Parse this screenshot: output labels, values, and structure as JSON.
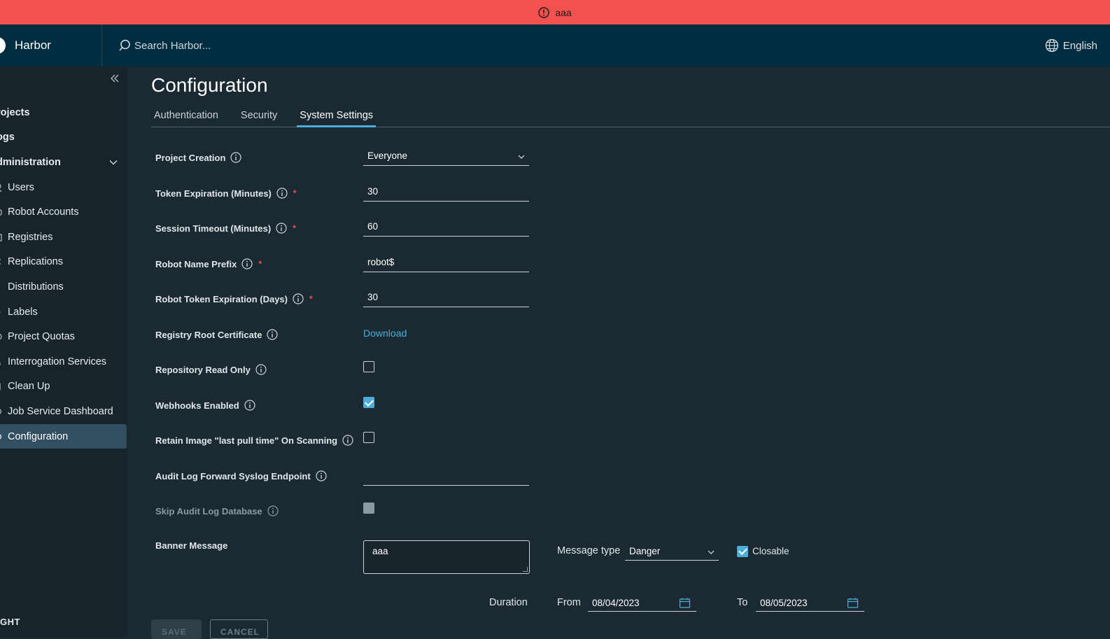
{
  "banner": {
    "text": "aaa",
    "color": "#f35150"
  },
  "header": {
    "brand": "Harbor",
    "search_placeholder": "Search Harbor...",
    "language": "English"
  },
  "sidebar": {
    "items": [
      {
        "label": "rojects"
      },
      {
        "label": "ogs"
      },
      {
        "label": "dministration"
      }
    ],
    "admin_items": [
      {
        "label": "Users"
      },
      {
        "label": "Robot Accounts"
      },
      {
        "label": "Registries"
      },
      {
        "label": "Replications"
      },
      {
        "label": "Distributions"
      },
      {
        "label": "Labels"
      },
      {
        "label": "Project Quotas"
      },
      {
        "label": "Interrogation Services"
      },
      {
        "label": "Clean Up"
      },
      {
        "label": "Job Service Dashboard"
      },
      {
        "label": "Configuration"
      }
    ],
    "bottom_text": "GHT"
  },
  "main": {
    "title": "Configuration",
    "tabs": [
      {
        "label": "Authentication"
      },
      {
        "label": "Security"
      },
      {
        "label": "System Settings"
      }
    ],
    "settings": {
      "project_creation": {
        "label": "Project Creation",
        "value": "Everyone"
      },
      "token_expiration": {
        "label": "Token Expiration (Minutes)",
        "value": "30",
        "required": "*"
      },
      "session_timeout": {
        "label": "Session Timeout (Minutes)",
        "value": "60",
        "required": "*"
      },
      "robot_name_prefix": {
        "label": "Robot Name Prefix",
        "value": "robot$",
        "required": "*"
      },
      "robot_token_expiration": {
        "label": "Robot Token Expiration (Days)",
        "value": "30",
        "required": "*"
      },
      "registry_root_cert": {
        "label": "Registry Root Certificate",
        "link": "Download"
      },
      "repo_read_only": {
        "label": "Repository Read Only",
        "checked": false
      },
      "webhooks_enabled": {
        "label": "Webhooks Enabled",
        "checked": true
      },
      "retain_image": {
        "label": "Retain Image \"last pull time\" On Scanning",
        "checked": false
      },
      "audit_log_endpoint": {
        "label": "Audit Log Forward Syslog Endpoint",
        "value": ""
      },
      "skip_audit_log": {
        "label": "Skip Audit Log Database",
        "checked": false,
        "disabled": true
      },
      "banner_message": {
        "label": "Banner Message",
        "value": "aaa",
        "message_type_label": "Message type",
        "message_type": "Danger",
        "closable_label": "Closable",
        "closable": true,
        "duration_label": "Duration",
        "from_label": "From",
        "from_date": "08/04/2023",
        "to_label": "To",
        "to_date": "08/05/2023"
      }
    },
    "buttons": {
      "save": "SAVE",
      "cancel": "CANCEL"
    }
  },
  "colors": {
    "accent": "#49afd9",
    "header_bg": "#002d3f",
    "page_bg": "#1b2a32",
    "sidebar_bg": "#17242b",
    "danger": "#f35150"
  }
}
